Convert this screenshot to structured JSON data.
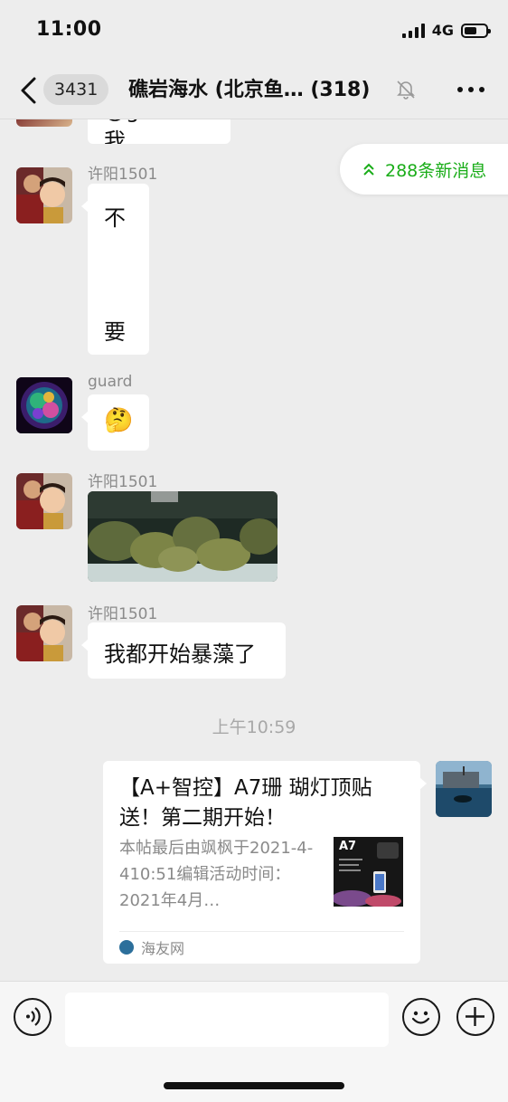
{
  "status_bar": {
    "time": "11:00",
    "network": "4G",
    "battery_level": 0.6
  },
  "nav": {
    "unread_count": "3431",
    "title": "礁岩海水 (北京鱼…  (318)"
  },
  "chat": {
    "partial_previous_message": "@guard 我",
    "new_messages": "288条新消息",
    "messages": [
      {
        "sender": "许阳1501",
        "lines": [
          "不",
          "要"
        ]
      },
      {
        "sender": "guard",
        "emoji": "🤔"
      },
      {
        "sender": "许阳1501",
        "image": "reef-aquarium-photo"
      },
      {
        "sender": "许阳1501",
        "text": "我都开始暴藻了"
      }
    ],
    "timestamp": "上午10:59",
    "link_card": {
      "title": "【A+智控】A7珊 瑚灯顶贴送！第二期开始！",
      "description": "本帖最后由飒枫于2021-4-410:51编辑活动时间：2021年4月…",
      "thumb_label": "A7",
      "source": "海友网"
    }
  },
  "icons": {
    "back": "chevron-left-icon",
    "mute": "bell-off-icon",
    "more": "more-dots-icon",
    "voice": "voice-icon",
    "emoji": "emoji-icon",
    "add": "plus-circle-icon"
  },
  "colors": {
    "accent_green": "#1aad19",
    "background": "#ededed",
    "bubble": "#ffffff"
  }
}
